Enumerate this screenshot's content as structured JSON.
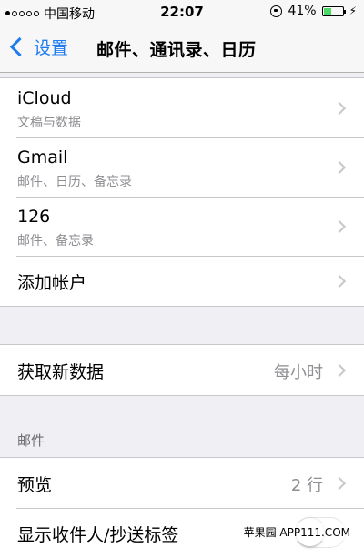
{
  "status": {
    "carrier": "中国移动",
    "time": "22:07",
    "battery": "41%",
    "battery_level": 0.41
  },
  "nav": {
    "back_label": "设置",
    "title": "邮件、通讯录、日历"
  },
  "accounts": [
    {
      "title": "iCloud",
      "subtitle": "文稿与数据"
    },
    {
      "title": "Gmail",
      "subtitle": "邮件、日历、备忘录"
    },
    {
      "title": "126",
      "subtitle": "邮件、备忘录"
    },
    {
      "title": "添加帐户"
    }
  ],
  "fetch": {
    "title": "获取新数据",
    "value": "每小时"
  },
  "mail_section": {
    "header": "邮件",
    "preview": {
      "title": "预览",
      "value": "2 行"
    },
    "show_to_cc": {
      "title": "显示收件人/抄送标签"
    }
  },
  "watermark": "苹果园 APP111.COM"
}
